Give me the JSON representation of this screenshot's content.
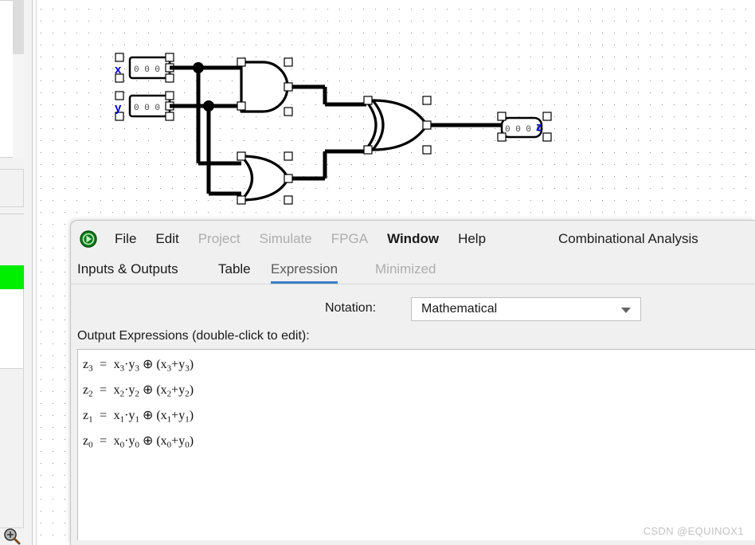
{
  "canvas": {
    "grid_color": "#8b8b8b",
    "background": "#ffffff",
    "wire_color": "#000000",
    "pin_label_color": "#0000dd",
    "inputs": [
      {
        "name": "x",
        "label": "x",
        "value": "0 0 0 0"
      },
      {
        "name": "y",
        "label": "y",
        "value": "0 0 0 0"
      }
    ],
    "outputs": [
      {
        "name": "z",
        "label": "z",
        "value": "0 0 0 0"
      }
    ],
    "gates": [
      {
        "name": "and-gate",
        "type": "AND"
      },
      {
        "name": "or-gate",
        "type": "OR"
      },
      {
        "name": "xor-gate",
        "type": "XOR"
      }
    ]
  },
  "window": {
    "title": "Combinational Analysis",
    "logo": "logisim-icon",
    "menu": [
      {
        "label": "File",
        "enabled": true,
        "bold": false
      },
      {
        "label": "Edit",
        "enabled": true,
        "bold": false
      },
      {
        "label": "Project",
        "enabled": false,
        "bold": false
      },
      {
        "label": "Simulate",
        "enabled": false,
        "bold": false
      },
      {
        "label": "FPGA",
        "enabled": false,
        "bold": false
      },
      {
        "label": "Window",
        "enabled": true,
        "bold": true
      },
      {
        "label": "Help",
        "enabled": true,
        "bold": false
      }
    ],
    "tabs": [
      {
        "label": "Inputs & Outputs",
        "state": "normal"
      },
      {
        "label": "Table",
        "state": "normal"
      },
      {
        "label": "Expression",
        "state": "selected"
      },
      {
        "label": "Minimized",
        "state": "disabled"
      }
    ],
    "accent_color": "#3c7fc8"
  },
  "notation": {
    "label": "Notation:",
    "value": "Mathematical",
    "caret": "chevron-down-icon"
  },
  "expressions": {
    "heading": "Output Expressions (double-click to edit):",
    "lines": [
      {
        "lhs": "z",
        "lhs_sub": "3",
        "rhs": "x<sub>3</sub>·y<sub>3</sub> ⊕ (x<sub>3</sub>+y<sub>3</sub>)",
        "plain": "z3 = x3·y3 ⊕ (x3+y3)"
      },
      {
        "lhs": "z",
        "lhs_sub": "2",
        "rhs": "x<sub>2</sub>·y<sub>2</sub> ⊕ (x<sub>2</sub>+y<sub>2</sub>)",
        "plain": "z2 = x2·y2 ⊕ (x2+y2)"
      },
      {
        "lhs": "z",
        "lhs_sub": "1",
        "rhs": "x<sub>1</sub>·y<sub>1</sub> ⊕ (x<sub>1</sub>+y<sub>1</sub>)",
        "plain": "z1 = x1·y1 ⊕ (x1+y1)"
      },
      {
        "lhs": "z",
        "lhs_sub": "0",
        "rhs": "x<sub>0</sub>·y<sub>0</sub> ⊕ (x<sub>0</sub>+y<sub>0</sub>)",
        "plain": "z0 = x0·y0 ⊕ (x0+y0)"
      }
    ],
    "equals": "="
  },
  "sidebar": {
    "selection_color": "#00ee00",
    "zoom_tool": "magnifier-plus-icon"
  },
  "watermark": "CSDN @EQUINOX1"
}
